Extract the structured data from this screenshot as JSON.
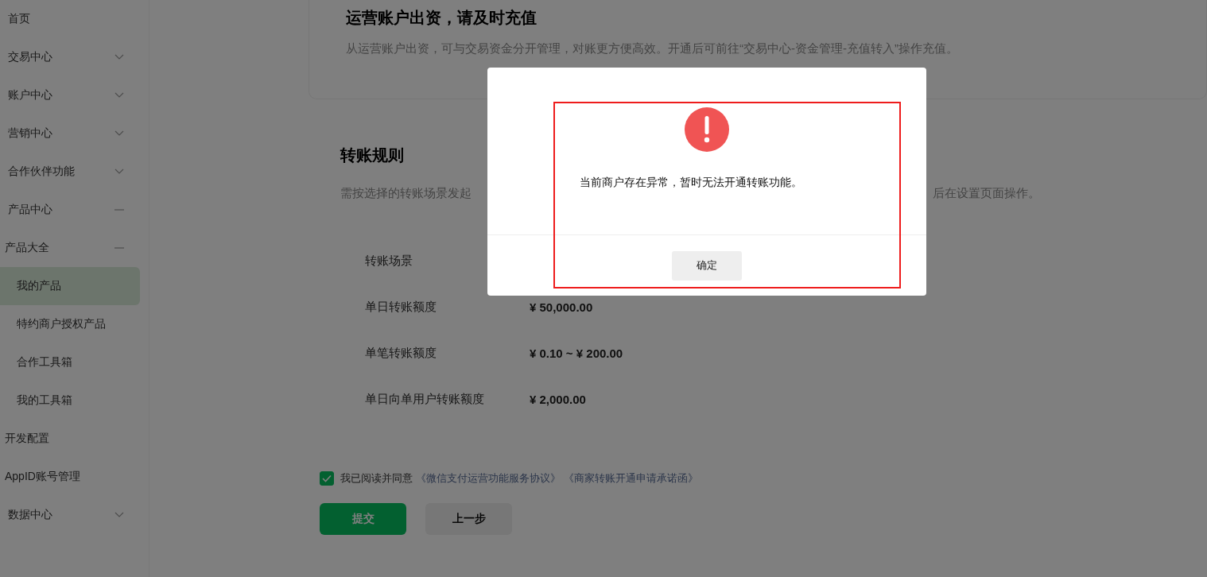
{
  "sidebar": {
    "items": [
      {
        "label": "首页",
        "selected": false
      },
      {
        "label": "交易中心",
        "expanded": false,
        "selected": false
      },
      {
        "label": "账户中心",
        "expanded": false,
        "selected": false
      },
      {
        "label": "营销中心",
        "expanded": false,
        "selected": false
      },
      {
        "label": "合作伙伴功能",
        "expanded": false,
        "selected": false
      },
      {
        "label": "产品中心",
        "expanded": true,
        "selected": false,
        "children": [
          {
            "label": "产品大全",
            "expanded": true,
            "selected": false,
            "children": [
              {
                "label": "我的产品",
                "selected": true
              },
              {
                "label": "特约商户授权产品",
                "selected": false
              },
              {
                "label": "合作工具箱",
                "selected": false
              },
              {
                "label": "我的工具箱",
                "selected": false
              }
            ]
          },
          {
            "label": "开发配置",
            "selected": false
          },
          {
            "label": "AppID账号管理",
            "selected": false
          }
        ]
      },
      {
        "label": "数据中心",
        "expanded": false,
        "selected": false
      }
    ]
  },
  "funding_card": {
    "title": "运营账户出资，请及时充值",
    "description": "从运营账户出资，可与交易资金分开管理，对账更方便高效。开通后可前往“交易中心-资金管理-充值转入”操作充值。"
  },
  "transfer_rules": {
    "title": "转账规则",
    "description_fragments": [
      "需按选择的转账场景发起",
      "后在设置页面操作。"
    ],
    "rows": [
      {
        "label": "转账场景"
      },
      {
        "label": "单日转账额度",
        "value": "¥ 50,000.00"
      },
      {
        "label": "单笔转账额度",
        "value": "¥ 0.10 ~ ¥ 200.00"
      },
      {
        "label": "单日向单用户转账额度",
        "value": "¥ 2,000.00"
      }
    ]
  },
  "agreement": {
    "checked": true,
    "text": "我已阅读并同意",
    "links": [
      "《微信支付运营功能服务协议》",
      "《商家转账开通申请承诺函》"
    ]
  },
  "buttons": [
    {
      "label": "提交",
      "kind": "primary"
    },
    {
      "label": "上一步",
      "kind": "secondary"
    }
  ],
  "dialog": {
    "message": "当前商户存在异常，暂时无法开通转账功能。",
    "confirm": "确定"
  }
}
